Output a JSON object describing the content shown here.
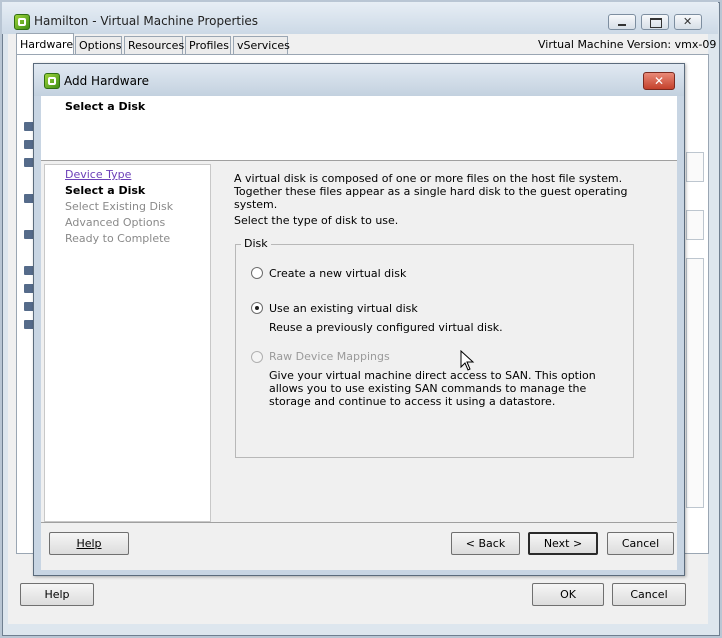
{
  "vm_window": {
    "title": "Hamilton - Virtual Machine Properties",
    "tabs": [
      "Hardware",
      "Options",
      "Resources",
      "Profiles",
      "vServices"
    ],
    "active_tab": "Hardware",
    "version_label": "Virtual Machine Version: vmx-09",
    "buttons": {
      "help": "Help",
      "ok": "OK",
      "cancel": "Cancel"
    }
  },
  "dialog": {
    "title": "Add Hardware",
    "header": "Select a Disk",
    "steps": [
      {
        "label": "Device Type",
        "state": "link"
      },
      {
        "label": "Select a Disk",
        "state": "current"
      },
      {
        "label": "Select Existing Disk",
        "state": "pending"
      },
      {
        "label": "Advanced Options",
        "state": "pending"
      },
      {
        "label": "Ready to Complete",
        "state": "pending"
      }
    ],
    "description": "A virtual disk is composed of one or more files on the host file system. Together these files appear as a single hard disk to the guest operating system.",
    "prompt": "Select the type of disk to use.",
    "group_label": "Disk",
    "options": [
      {
        "label": "Create a new virtual disk",
        "sub": "",
        "selected": false,
        "disabled": false
      },
      {
        "label": "Use an existing virtual disk",
        "sub": "Reuse a previously configured virtual disk.",
        "selected": true,
        "disabled": false
      },
      {
        "label": "Raw Device Mappings",
        "sub": "Give your virtual machine direct access to SAN. This option allows you to use existing SAN commands to manage the storage and continue to access it using a datastore.",
        "selected": false,
        "disabled": true
      }
    ],
    "buttons": {
      "help": "Help",
      "back": "< Back",
      "next": "Next >",
      "cancel": "Cancel"
    }
  }
}
